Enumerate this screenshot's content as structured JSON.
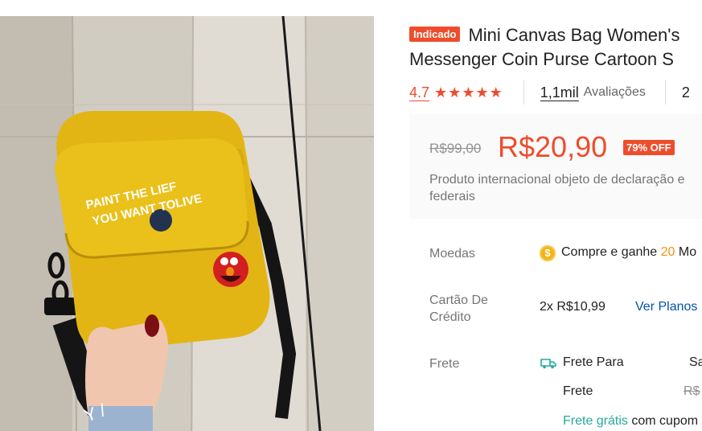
{
  "product": {
    "badge": "Indicado",
    "title_line1": "Mini Canvas Bag Women's",
    "title_line2": "Messenger Coin Purse Cartoon S",
    "image_print_line1": "PAINT THE LIEF",
    "image_print_line2": "YOU WANT TOLIVE"
  },
  "rating": {
    "score": "4.7",
    "stars": 5,
    "reviews_count": "1,1mil",
    "reviews_label": "Avaliações",
    "sold_count": "2"
  },
  "price": {
    "old": "R$99,00",
    "current": "R$20,90",
    "discount": "79% OFF",
    "note": "Produto internacional objeto de declaração e federais"
  },
  "info": {
    "coins_label": "Moedas",
    "coins_prefix": "Compre e ganhe ",
    "coins_amount": "20",
    "coins_suffix": " Mo",
    "credit_label": "Cartão De Crédito",
    "credit_installment": "2x R$10,99",
    "credit_link": "Ver Planos",
    "shipping_label": "Frete",
    "shipping_to": "Frete Para",
    "shipping_dest": "Sa",
    "shipping_cost_label": "Frete",
    "shipping_old": "R$",
    "free_shipping": "Frete grátis",
    "free_shipping_suffix": " com cupom"
  },
  "colors": {
    "accent": "#ee4d2d",
    "coin": "#f69113",
    "link": "#0055aa",
    "free_shipping": "#26aa99"
  }
}
